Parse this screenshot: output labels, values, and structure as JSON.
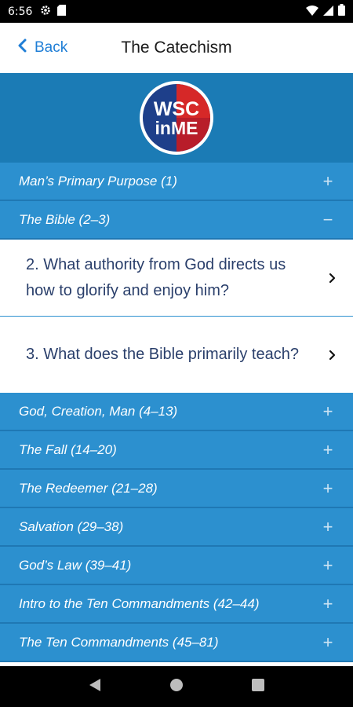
{
  "status": {
    "time": "6:56"
  },
  "nav": {
    "back_label": "Back",
    "title": "The Catechism"
  },
  "logo": {
    "line1": "WSC",
    "line2": "inME",
    "colors": {
      "blue": "#1e3f8a",
      "red": "#d62828"
    }
  },
  "sections": [
    {
      "label": "Man’s Primary Purpose (1)",
      "toggle": "+"
    },
    {
      "label": "The Bible  (2–3)",
      "toggle": "−"
    },
    {
      "label": "God, Creation, Man (4–13)",
      "toggle": "+"
    },
    {
      "label": "The Fall (14–20)",
      "toggle": "+"
    },
    {
      "label": "The Redeemer (21–28)",
      "toggle": "+"
    },
    {
      "label": "Salvation (29–38)",
      "toggle": "+"
    },
    {
      "label": "God’s Law (39–41)",
      "toggle": "+"
    },
    {
      "label": "Intro to the Ten Commandments (42–44)",
      "toggle": "+"
    },
    {
      "label": "The Ten Commandments (45–81)",
      "toggle": "+"
    }
  ],
  "questions": [
    {
      "text": "2. What authority from God directs us how to glorify and enjoy him?"
    },
    {
      "text": "3. What does the Bible primarily teach?"
    }
  ],
  "theme": {
    "accent": "#1f7ed6",
    "section_bg": "#2c90cf",
    "banner_bg": "#1b7bb5"
  }
}
